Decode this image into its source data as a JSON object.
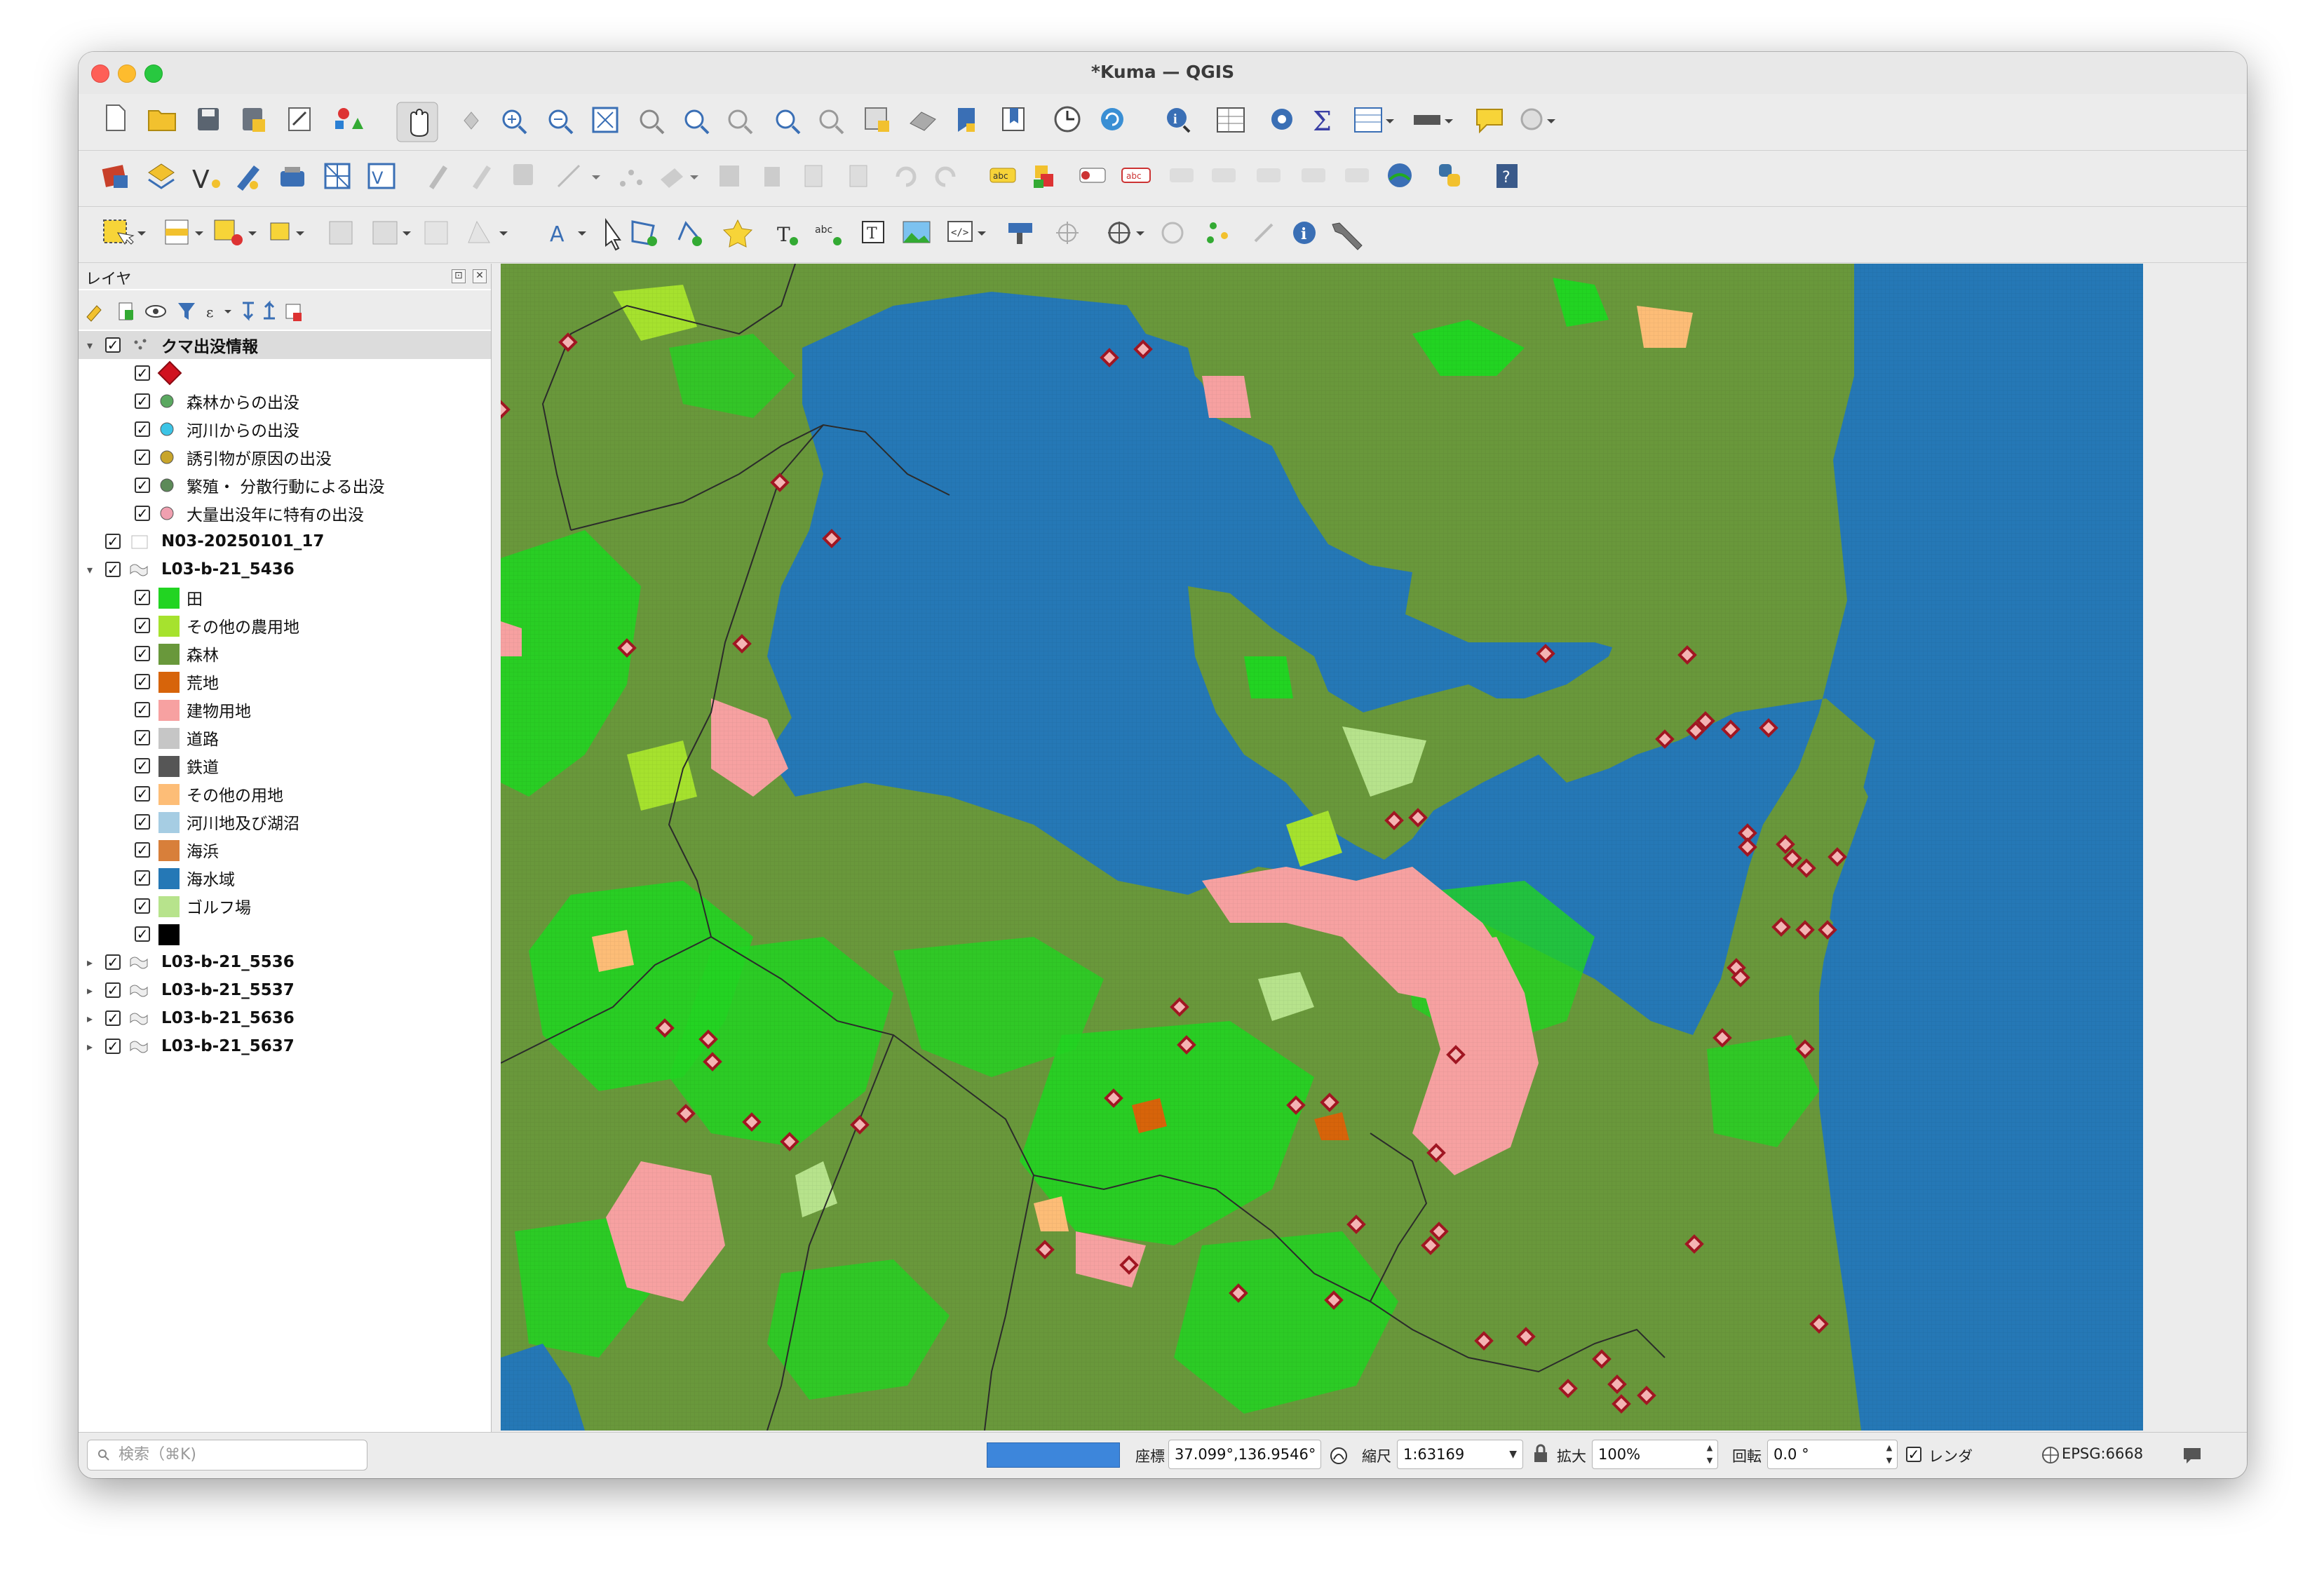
{
  "window": {
    "title": "*Kuma — QGIS"
  },
  "layers_panel": {
    "title": "レイヤ",
    "groups": [
      {
        "name": "クマ出没情報",
        "items": [
          {
            "label": "",
            "symbol": "red-diamond"
          },
          {
            "label": "森林からの出没",
            "color": "#5aa860"
          },
          {
            "label": "河川からの出没",
            "color": "#3cc4e6"
          },
          {
            "label": "誘引物が原因の出没",
            "color": "#c8a52c"
          },
          {
            "label": "繁殖・ 分散行動による出没",
            "color": "#5c8a58"
          },
          {
            "label": "大量出没年に特有の出没",
            "color": "#f0a0b0"
          }
        ]
      },
      {
        "name": "N03-20250101_17"
      },
      {
        "name": "L03-b-21_5436",
        "items": [
          {
            "label": "田",
            "color": "#22d422"
          },
          {
            "label": "その他の農用地",
            "color": "#a6e22e"
          },
          {
            "label": "森林",
            "color": "#69983b"
          },
          {
            "label": "荒地",
            "color": "#d7640a"
          },
          {
            "label": "建物用地",
            "color": "#f7a1a1"
          },
          {
            "label": "道路",
            "color": "#c6c6c6"
          },
          {
            "label": "鉄道",
            "color": "#565656"
          },
          {
            "label": "その他の用地",
            "color": "#fdbd77"
          },
          {
            "label": "河川地及び湖沼",
            "color": "#a6cde3"
          },
          {
            "label": "海浜",
            "color": "#d87f3a"
          },
          {
            "label": "海水域",
            "color": "#2578b6"
          },
          {
            "label": "ゴルフ場",
            "color": "#b7e38c"
          },
          {
            "label": "",
            "color": "#000000"
          }
        ]
      },
      {
        "name": "L03-b-21_5536"
      },
      {
        "name": "L03-b-21_5537"
      },
      {
        "name": "L03-b-21_5636"
      },
      {
        "name": "L03-b-21_5637"
      }
    ]
  },
  "statusbar": {
    "search_placeholder": "検索（⌘K)",
    "coord_label": "座標",
    "coord_value": "37.099°,136.9546°",
    "scale_label": "縮尺",
    "scale_value": "1:63169",
    "magnifier_label": "拡大",
    "magnifier_value": "100%",
    "rotation_label": "回転",
    "rotation_value": "0.0 °",
    "render_label": "レンダ",
    "crs_value": "EPSG:6668"
  }
}
